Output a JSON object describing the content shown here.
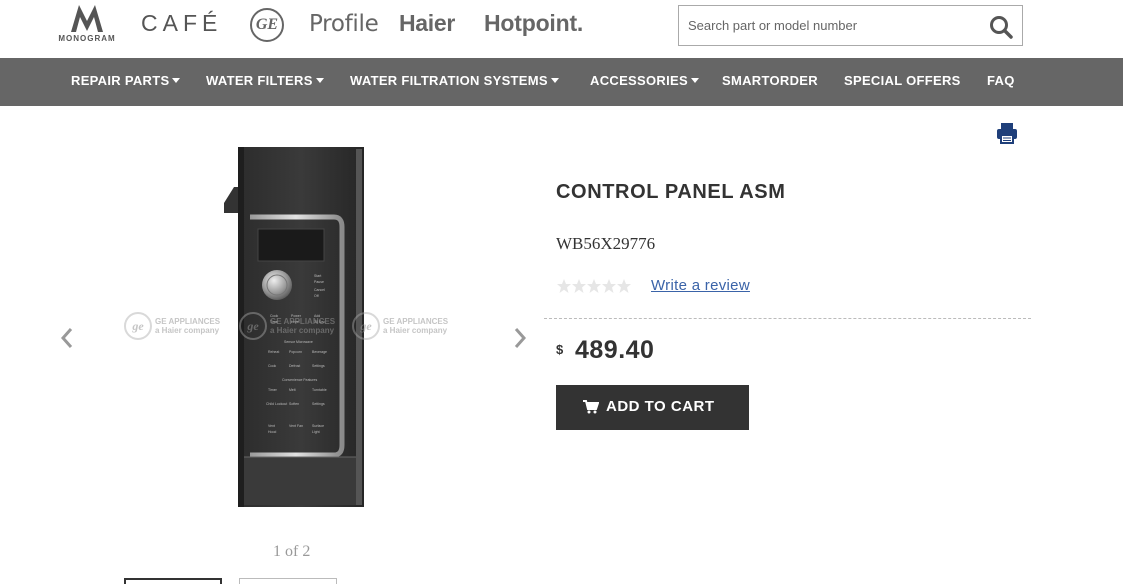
{
  "header": {
    "brands": {
      "monogram_text": "MONOGRAM",
      "cafe": "CAFÉ",
      "ge": "GE",
      "profile": "Profile",
      "haier": "Haier",
      "hotpoint": "Hotpoint."
    },
    "search": {
      "placeholder": "Search part or model number",
      "value": ""
    }
  },
  "nav": {
    "items": [
      {
        "label": "REPAIR PARTS",
        "has_dropdown": true
      },
      {
        "label": "WATER FILTERS",
        "has_dropdown": true
      },
      {
        "label": "WATER FILTRATION SYSTEMS",
        "has_dropdown": true
      },
      {
        "label": "ACCESSORIES",
        "has_dropdown": true
      },
      {
        "label": "SMARTORDER",
        "has_dropdown": false
      },
      {
        "label": "SPECIAL OFFERS",
        "has_dropdown": false
      },
      {
        "label": "FAQ",
        "has_dropdown": false
      }
    ]
  },
  "product": {
    "title": "CONTROL PANEL ASM",
    "part_number": "WB56X29776",
    "rating_stars": 0,
    "review_link": "Write a review",
    "currency_symbol": "$",
    "price": "489.40",
    "add_to_cart": "ADD TO CART"
  },
  "gallery": {
    "pager": "1 of 2",
    "watermark_brand": "GE APPLIANCES",
    "watermark_sub": "a Haier company"
  },
  "icons": {
    "print": "print-icon",
    "search": "search-icon",
    "cart": "cart-icon",
    "prev": "chevron-left-icon",
    "next": "chevron-right-icon"
  },
  "colors": {
    "nav_bg": "#666666",
    "button_bg": "#333333",
    "link": "#3a63a8",
    "print_icon": "#1f3f7a"
  }
}
